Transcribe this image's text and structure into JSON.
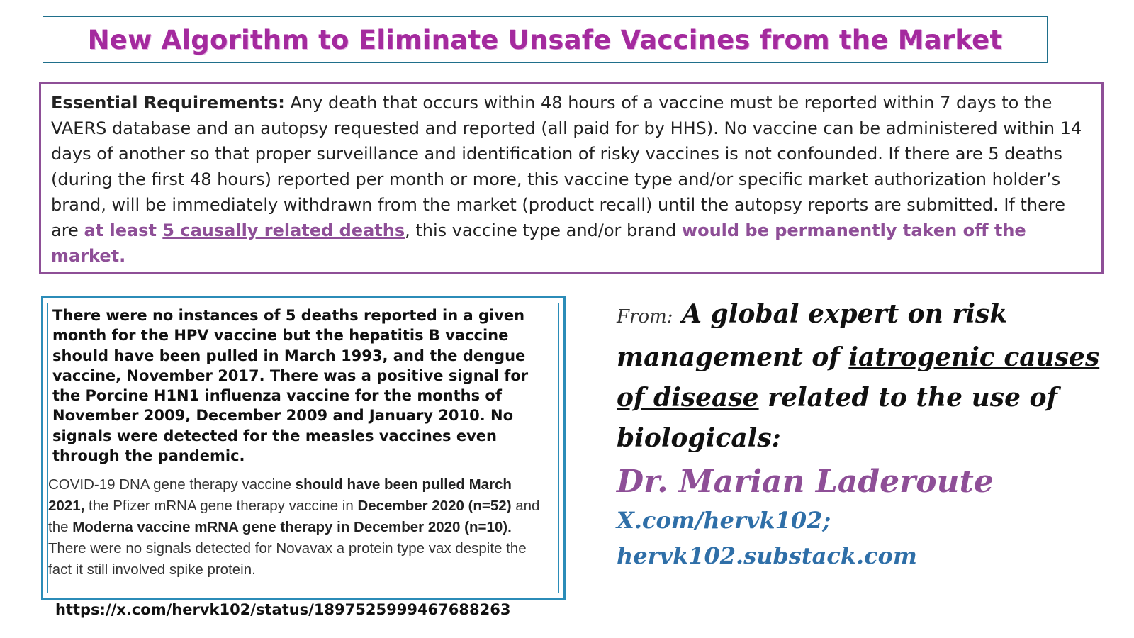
{
  "title": "New Algorithm to Eliminate Unsafe Vaccines from the Market",
  "requirements": {
    "lead": "Essential Requirements:",
    "body": " Any death that occurs within 48 hours of a vaccine must be reported within 7 days to the VAERS database and an autopsy requested and reported (all paid for by HHS). No vaccine can be administered within 14 days of another so that proper surveillance and identification of risky vaccines is not confounded.  If there are 5 deaths (during the first 48 hours) reported per month or more, this vaccine type and/or specific market authorization holder’s brand, will be immediately withdrawn from the market (product recall) until the autopsy reports are submitted. If there are ",
    "highlight_prefix": "at least ",
    "highlight_underlined": "5 causally related deaths",
    "mid": ", this vaccine type and/or brand ",
    "highlight_end": "would be permanently taken off the market."
  },
  "findings": {
    "bold_paragraph": "There were no instances of 5 deaths reported in a given month for the HPV vaccine but the hepatitis B vaccine should have been pulled in March 1993, and the dengue vaccine, November 2017. There was a positive signal for the Porcine H1N1 influenza vaccine for the months of  November 2009, December 2009 and January 2010. No signals were detected for the measles vaccines even through the pandemic.",
    "covid_1": "COVID-19  DNA gene therapy vaccine ",
    "covid_2": "should have been pulled March 2021,",
    "covid_3": " the Pfizer mRNA gene therapy  vaccine in ",
    "covid_4": "December 2020 (n=52)",
    "covid_5": " and the ",
    "covid_6": "Moderna vaccine mRNA gene therapy in December 2020 (n=10).",
    "covid_7": " There were no signals detected for Novavax a protein type vax despite the fact it  still involved spike protein."
  },
  "source_url": "https://x.com/hervk102/status/1897525999467688263",
  "attribution": {
    "from_label": "From:",
    "text_1": " A global expert on risk management of ",
    "underlined_1": "iatrogenic causes of disease",
    "text_2": " related to the use of biologicals:",
    "name": "Dr. Marian Laderoute",
    "link_1": "X.com/hervk102;",
    "link_2": "hervk102.substack.com"
  },
  "colors": {
    "title": "#a42a9e",
    "accent_purple": "#8e4f97",
    "box_blue": "#2b8cb8",
    "link_blue": "#2f6fa8"
  }
}
